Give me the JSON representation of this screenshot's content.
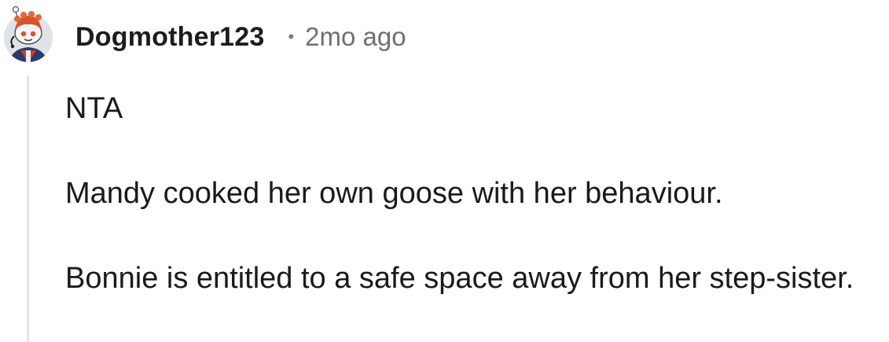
{
  "comment": {
    "username": "Dogmother123",
    "separator": "•",
    "timestamp": "2mo ago",
    "avatar_icon": "snoo-avatar-icon",
    "paragraphs": [
      "NTA",
      "Mandy cooked her own goose with her behaviour.",
      "Bonnie is entitled to a safe space away from her step-sister."
    ]
  },
  "colors": {
    "username": "#1c1c1c",
    "timestamp": "#6f7071",
    "thread_line": "#e3e3e3",
    "avatar_accent": "#d9532b"
  }
}
